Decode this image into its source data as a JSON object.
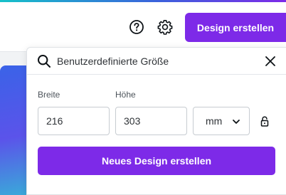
{
  "header": {
    "help_icon": "question-circle-icon",
    "settings_icon": "gear-icon",
    "create_label": "Design erstellen"
  },
  "panel": {
    "search": {
      "value": "Benutzerdefinierte Größe",
      "icon": "search-icon",
      "close_icon": "close-icon"
    },
    "width_label": "Breite",
    "height_label": "Höhe",
    "width_value": "216",
    "height_value": "303",
    "unit_value": "mm",
    "lock_icon": "lock-icon",
    "submit_label": "Neues Design erstellen"
  },
  "colors": {
    "accent": "#7d2ae8",
    "border": "#c7ccd1",
    "text": "#2f3337"
  }
}
